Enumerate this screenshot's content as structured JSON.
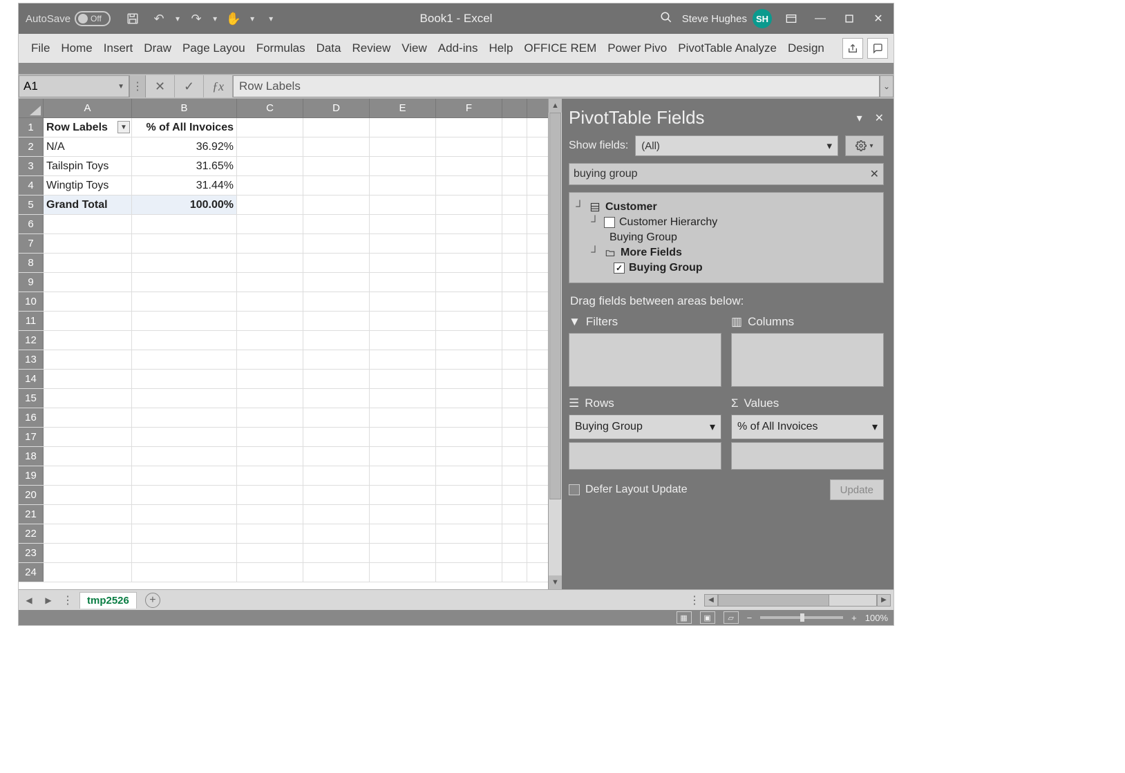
{
  "titlebar": {
    "autosave_label": "AutoSave",
    "autosave_state": "Off",
    "doc_title": "Book1  -  Excel",
    "user_name": "Steve Hughes",
    "user_initials": "SH"
  },
  "ribbon": {
    "tabs": [
      "File",
      "Home",
      "Insert",
      "Draw",
      "Page Layou",
      "Formulas",
      "Data",
      "Review",
      "View",
      "Add-ins",
      "Help",
      "OFFICE REM",
      "Power Pivo",
      "PivotTable Analyze",
      "Design"
    ]
  },
  "formula": {
    "namebox": "A1",
    "fx_text": "Row Labels"
  },
  "grid": {
    "cols": [
      "A",
      "B",
      "C",
      "D",
      "E",
      "F"
    ],
    "rows": [
      {
        "n": "1",
        "A": "Row Labels",
        "B": "% of All Invoices",
        "bold": true,
        "dd": true
      },
      {
        "n": "2",
        "A": "N/A",
        "B": "36.92%"
      },
      {
        "n": "3",
        "A": "Tailspin Toys",
        "B": "31.65%"
      },
      {
        "n": "4",
        "A": "Wingtip Toys",
        "B": "31.44%"
      },
      {
        "n": "5",
        "A": "Grand Total",
        "B": "100.00%",
        "bold": true,
        "gt": true
      },
      {
        "n": "6"
      },
      {
        "n": "7"
      },
      {
        "n": "8"
      },
      {
        "n": "9"
      },
      {
        "n": "10"
      },
      {
        "n": "11"
      },
      {
        "n": "12"
      },
      {
        "n": "13"
      },
      {
        "n": "14"
      },
      {
        "n": "15"
      },
      {
        "n": "16"
      },
      {
        "n": "17"
      },
      {
        "n": "18"
      },
      {
        "n": "19"
      },
      {
        "n": "20"
      },
      {
        "n": "21"
      },
      {
        "n": "22"
      },
      {
        "n": "23"
      },
      {
        "n": "24"
      }
    ]
  },
  "pane": {
    "title": "PivotTable Fields",
    "show_label": "Show fields:",
    "show_value": "(All)",
    "search_value": "buying group",
    "fields": {
      "customer": "Customer",
      "customer_hierarchy": "Customer Hierarchy",
      "buying_group_plain": "Buying Group",
      "more_fields": "More Fields",
      "buying_group_chk": "Buying Group"
    },
    "hint": "Drag fields between areas below:",
    "areas": {
      "filters": "Filters",
      "columns": "Columns",
      "rows": "Rows",
      "values": "Values"
    },
    "chips": {
      "rows": "Buying Group",
      "values": "% of All Invoices"
    },
    "defer_label": "Defer Layout Update",
    "update_btn": "Update"
  },
  "tabs": {
    "sheet": "tmp2526"
  },
  "status": {
    "zoom": "100%"
  }
}
